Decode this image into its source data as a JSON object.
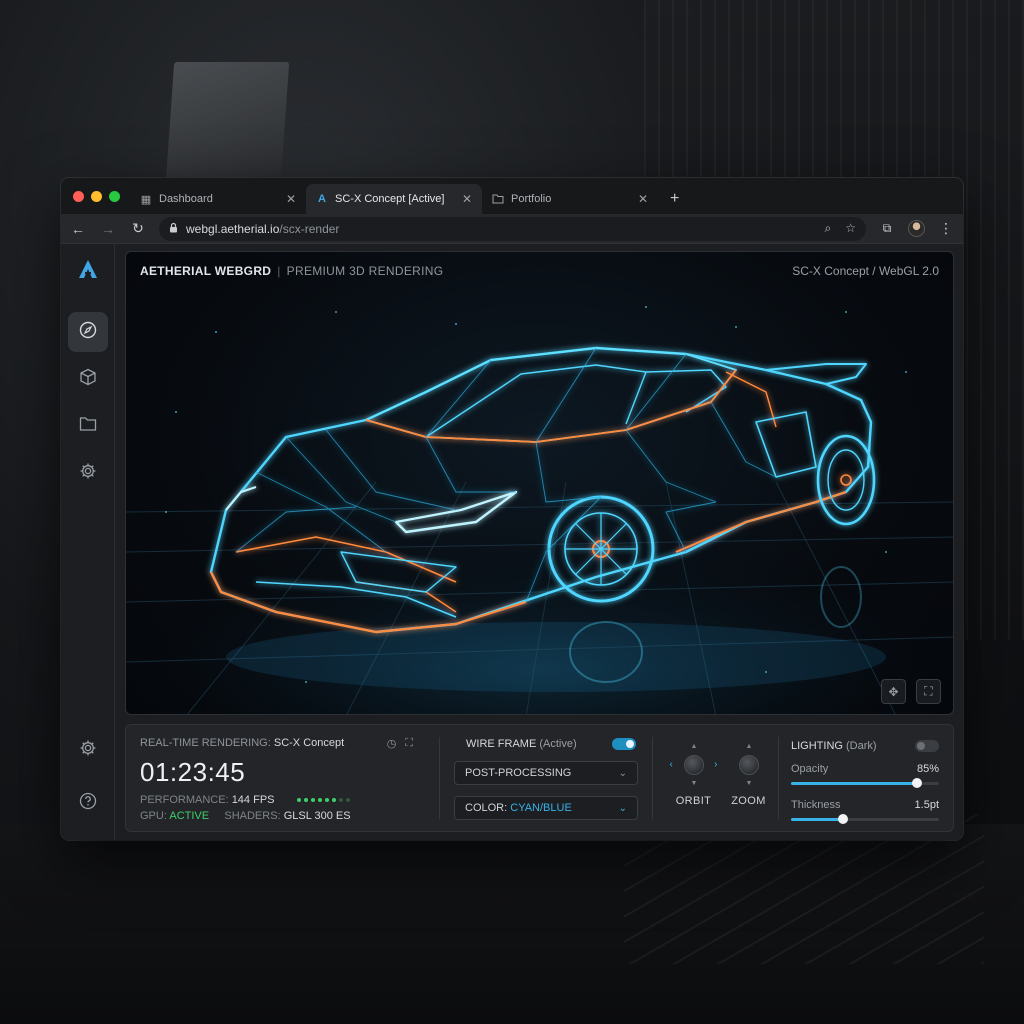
{
  "browser": {
    "tabs": [
      {
        "label": "Dashboard",
        "icon": "grid-icon",
        "active": false
      },
      {
        "label": "SC-X Concept [Active]",
        "icon": "aetherial-logo-icon",
        "active": true
      },
      {
        "label": "Portfolio",
        "icon": "folder-icon",
        "active": false
      }
    ],
    "url_host": "webgl.aetherial.io",
    "url_path": "/scx-render"
  },
  "sidebar": {
    "items": [
      "compass-icon",
      "cube-icon",
      "folder-icon",
      "gear-icon"
    ],
    "bottom": [
      "settings-icon",
      "help-icon"
    ]
  },
  "viewport": {
    "brand": "AETHERIAL WEBGRD",
    "subtitle": "PREMIUM 3D RENDERING",
    "model_info": "SC-X Concept / WebGL 2.0"
  },
  "panel": {
    "rt_label": "REAL-TIME RENDERING:",
    "rt_model": "SC-X Concept",
    "timer": "01:23:45",
    "perf_label": "PERFORMANCE:",
    "perf_value": "144 FPS",
    "perf_level": 6,
    "perf_max": 8,
    "gpu_label": "GPU:",
    "gpu_value": "ACTIVE",
    "shaders_label": "SHADERS:",
    "shaders_value": "GLSL 300 ES",
    "wireframe_label": "WIRE FRAME",
    "wireframe_state": "(Active)",
    "wireframe_on": true,
    "postprocessing_label": "POST-PROCESSING",
    "color_label": "COLOR:",
    "color_value": "CYAN/BLUE",
    "orbit_label": "ORBIT",
    "zoom_label": "ZOOM",
    "lighting_label": "LIGHTING",
    "lighting_state": "(Dark)",
    "lighting_on": false,
    "opacity_label": "Opacity",
    "opacity_value": "85%",
    "opacity_fraction": 0.85,
    "thickness_label": "Thickness",
    "thickness_value": "1.5pt",
    "thickness_fraction": 0.35
  },
  "colors": {
    "accent": "#37b3e8",
    "wire_cyan": "#4fd6ff",
    "wire_orange": "#ff8a3d",
    "success": "#3ecf6b"
  }
}
